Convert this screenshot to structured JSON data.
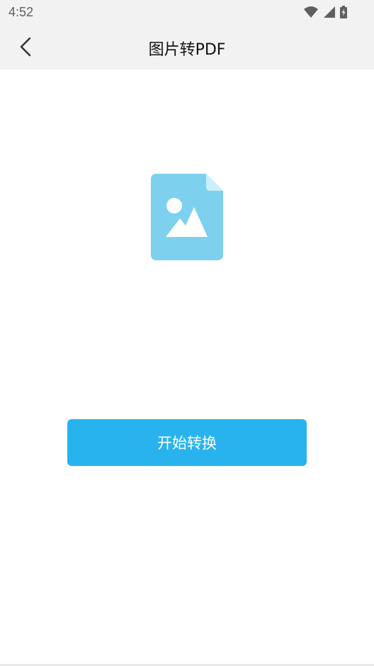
{
  "status_bar": {
    "time": "4:52",
    "icons": [
      "wifi-icon",
      "signal-icon",
      "battery-charging-icon"
    ]
  },
  "app_bar": {
    "back_icon": "back-arrow-icon",
    "title": "图片转PDF"
  },
  "main": {
    "illustration": "image-file-icon",
    "convert_button_label": "开始转换"
  },
  "colors": {
    "accent": "#29b3ee",
    "icon_blue": "#7dd1ef",
    "header_bg": "#f2f2f2"
  }
}
